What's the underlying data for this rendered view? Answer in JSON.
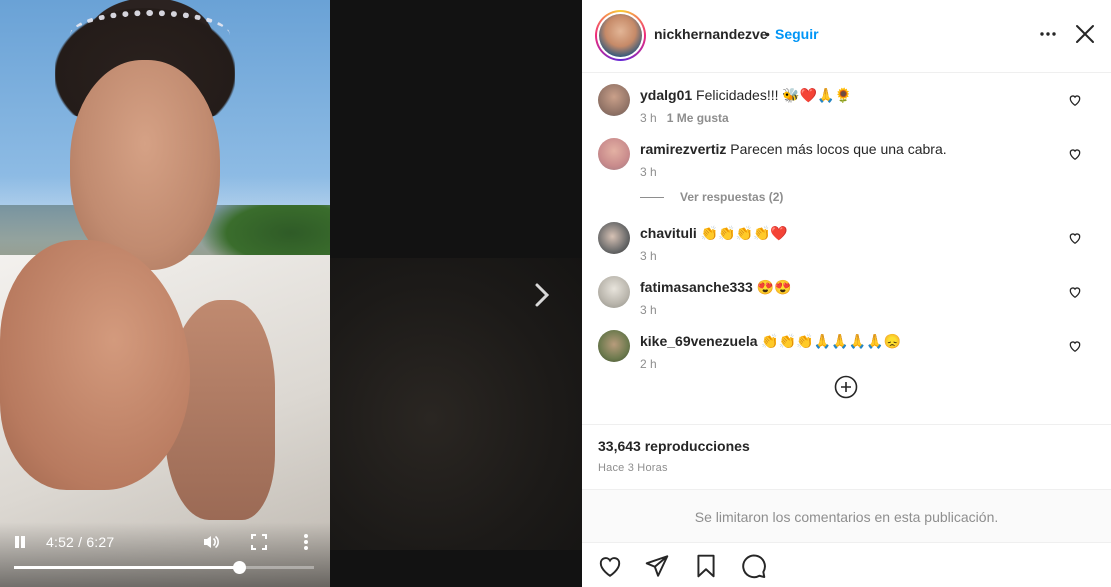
{
  "video": {
    "current_time": "4:52",
    "duration": "6:27",
    "time_display": "4:52 / 6:27",
    "progress_fraction": 0.75
  },
  "post": {
    "owner_username": "nickhernandezve",
    "separator": "•",
    "follow_label": "Seguir",
    "views": "33,643 reproducciones",
    "posted_ago": "Hace 3 Horas",
    "comments_limited_notice": "Se limitaron los comentarios en esta publicación."
  },
  "comments": [
    {
      "username": "ydalg01",
      "text": "Felicidades!!! 🐝❤️🙏🌻",
      "time": "3 h",
      "likes": "1 Me gusta"
    },
    {
      "username": "ramirezvertiz",
      "text": "Parecen más locos que una cabra.",
      "time": "3 h",
      "likes": ""
    },
    {
      "username": "chavituli",
      "text": "👏👏👏👏❤️",
      "time": "3 h",
      "likes": ""
    },
    {
      "username": "fatimasanche333",
      "text": "😍😍",
      "time": "3 h",
      "likes": ""
    },
    {
      "username": "kike_69venezuela",
      "text": "👏👏👏🙏🙏🙏🙏😞",
      "time": "2 h",
      "likes": ""
    }
  ],
  "replies_link": "Ver respuestas (2)",
  "icons": {
    "pause": "pause-icon",
    "volume": "volume-icon",
    "fullscreen": "fullscreen-icon",
    "more": "more-vertical-icon",
    "next": "chevron-right-icon",
    "options": "more-horizontal-icon",
    "close": "close-icon",
    "heart": "heart-icon",
    "share": "paper-plane-icon",
    "save": "bookmark-icon",
    "comment": "comment-icon",
    "load_more": "plus-circle-icon"
  },
  "colors": {
    "follow_blue": "#0095f6",
    "text_primary": "#262626",
    "text_secondary": "#8e8e8e",
    "like_red": "#ed4956"
  }
}
